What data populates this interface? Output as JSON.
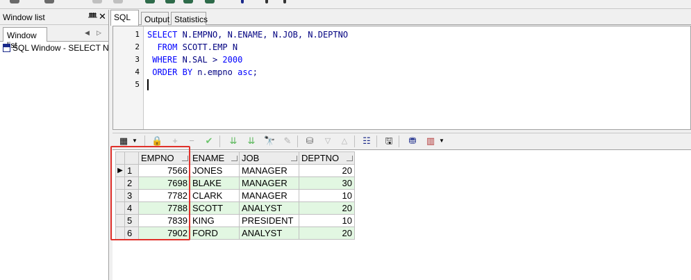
{
  "left_panel": {
    "title": "Window list",
    "pin_glyph": "ᚙ",
    "close_glyph": "✕",
    "tab_label": "Window list",
    "items": [
      {
        "label": "SQL Window - SELECT N.EMPNO, N.ENAME, N.JOB, N.DEPTNO"
      }
    ]
  },
  "editor": {
    "tabs": [
      {
        "label": "SQL",
        "active": true
      },
      {
        "label": "Output",
        "active": false
      },
      {
        "label": "Statistics",
        "active": false
      }
    ],
    "lines": [
      {
        "n": "1",
        "text": "SELECT N.EMPNO, N.ENAME, N.JOB, N.DEPTNO"
      },
      {
        "n": "2",
        "text": "  FROM SCOTT.EMP N"
      },
      {
        "n": "3",
        "text": " WHERE N.SAL > 2000"
      },
      {
        "n": "4",
        "text": " ORDER BY n.empno asc;"
      },
      {
        "n": "5",
        "text": ""
      }
    ]
  },
  "grid_toolbar": {
    "icons": [
      "grid-menu-icon",
      "lock-icon",
      "add-record-icon",
      "delete-record-icon",
      "post-changes-icon",
      "fetch-next-icon",
      "fetch-last-icon",
      "find-icon",
      "clear-icon",
      "query-by-example-icon",
      "previous-icon",
      "next-icon",
      "explain-plan-icon",
      "save-icon",
      "export-icon",
      "chart-icon"
    ]
  },
  "results": {
    "columns": [
      "EMPNO",
      "ENAME",
      "JOB",
      "DEPTNO"
    ],
    "rows": [
      {
        "rn": "1",
        "empno": "7566",
        "ename": "JONES",
        "job": "MANAGER",
        "deptno": "20"
      },
      {
        "rn": "2",
        "empno": "7698",
        "ename": "BLAKE",
        "job": "MANAGER",
        "deptno": "30"
      },
      {
        "rn": "3",
        "empno": "7782",
        "ename": "CLARK",
        "job": "MANAGER",
        "deptno": "10"
      },
      {
        "rn": "4",
        "empno": "7788",
        "ename": "SCOTT",
        "job": "ANALYST",
        "deptno": "20"
      },
      {
        "rn": "5",
        "empno": "7839",
        "ename": "KING",
        "job": "PRESIDENT",
        "deptno": "10"
      },
      {
        "rn": "6",
        "empno": "7902",
        "ename": "FORD",
        "job": "ANALYST",
        "deptno": "20"
      }
    ],
    "current_row_indicator": "▶"
  },
  "colors": {
    "highlight": "#e0302a",
    "even_row": "#e2f7e2",
    "keyword": "#0000ff"
  }
}
